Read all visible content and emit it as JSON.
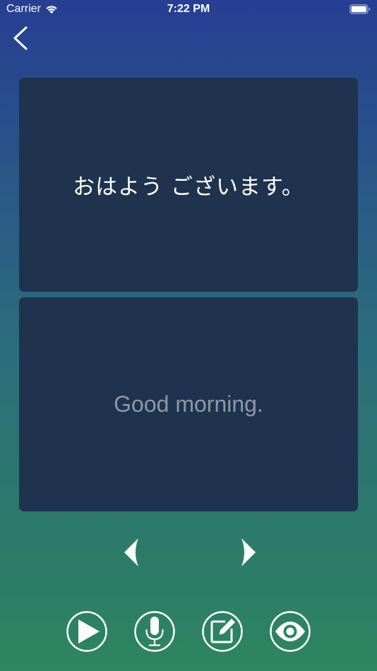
{
  "status_bar": {
    "carrier": "Carrier",
    "time": "7:22 PM"
  },
  "card": {
    "front_text": "おはよう ございます。",
    "back_text": "Good morning."
  },
  "icons": {
    "back": "chevron-left-icon",
    "prev": "arrow-left-icon",
    "next": "arrow-right-icon",
    "play": "play-icon",
    "mic": "microphone-icon",
    "edit": "edit-icon",
    "eye": "eye-icon"
  },
  "colors": {
    "gradient_top": "#273e93",
    "gradient_bottom": "#2c8660",
    "card_background": "#1f334f",
    "back_text": "#8e98a6"
  }
}
